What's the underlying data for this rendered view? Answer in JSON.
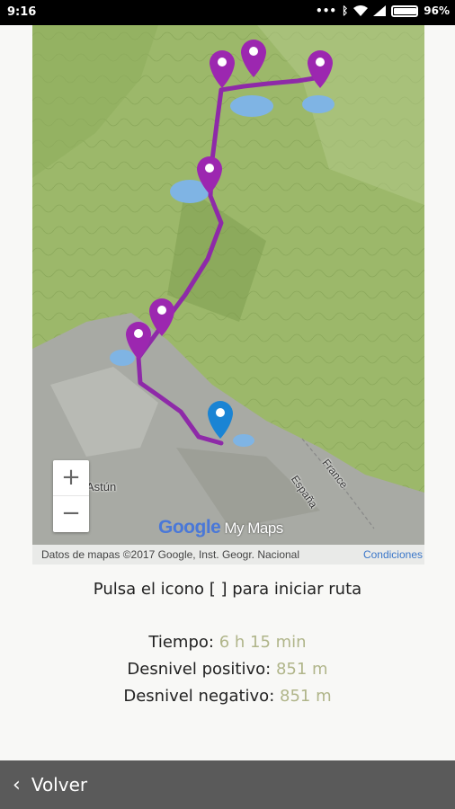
{
  "status_bar": {
    "time": "9:16",
    "battery": "96%",
    "battery_level": 0.96,
    "indicators": [
      "more-dots",
      "bluetooth",
      "wifi",
      "signal"
    ]
  },
  "map": {
    "labels": {
      "place": "Astún",
      "france": "France",
      "espana": "España"
    },
    "brand": {
      "google": "Google",
      "mymaps": "My Maps"
    },
    "attribution": "Datos de mapas ©2017 Google, Inst. Geogr. Nacional",
    "conditions_link": "Condiciones",
    "zoom_in": "+",
    "zoom_out": "−",
    "colors": {
      "route": "#8e2aa8",
      "marker": "#9c27b0",
      "start_marker": "#1a84d4",
      "terrain": "#9cb86a",
      "rock": "#a8aaa4",
      "lake": "#7fb4e4"
    }
  },
  "instruction": "Pulsa el icono [ ] para iniciar ruta",
  "stats": {
    "time_label": "Tiempo:",
    "time_value": "6 h 15 min",
    "ascent_label": "Desnivel positivo:",
    "ascent_value": "851 m",
    "descent_label": "Desnivel negativo:",
    "descent_value": "851 m"
  },
  "nav": {
    "back_label": "Volver"
  }
}
